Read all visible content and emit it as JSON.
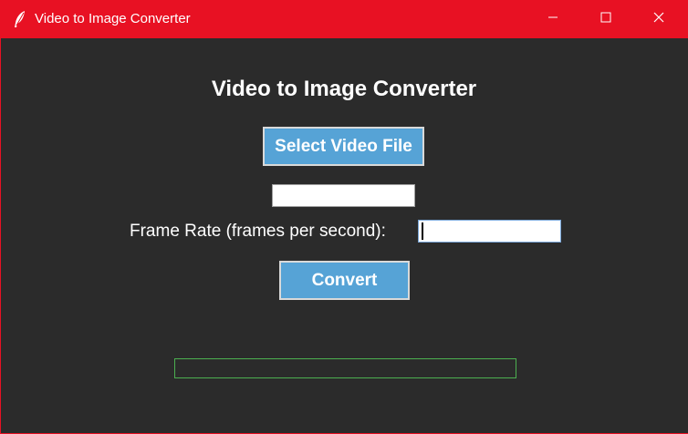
{
  "window": {
    "title": "Video to Image Converter",
    "titlebar_color": "#e81123",
    "background_color": "#2b2b2b",
    "app_icon": "feather-icon",
    "controls": [
      "minimize-icon",
      "maximize-icon",
      "close-icon"
    ]
  },
  "main": {
    "heading": "Video to Image Converter",
    "select_button_label": "Select Video File",
    "file_path_value": "",
    "frame_rate_label": "Frame Rate (frames per second):",
    "frame_rate_value": "",
    "convert_button_label": "Convert",
    "button_color": "#56a3d6",
    "progress_fraction": 0,
    "progress_color": "#4caf50"
  }
}
